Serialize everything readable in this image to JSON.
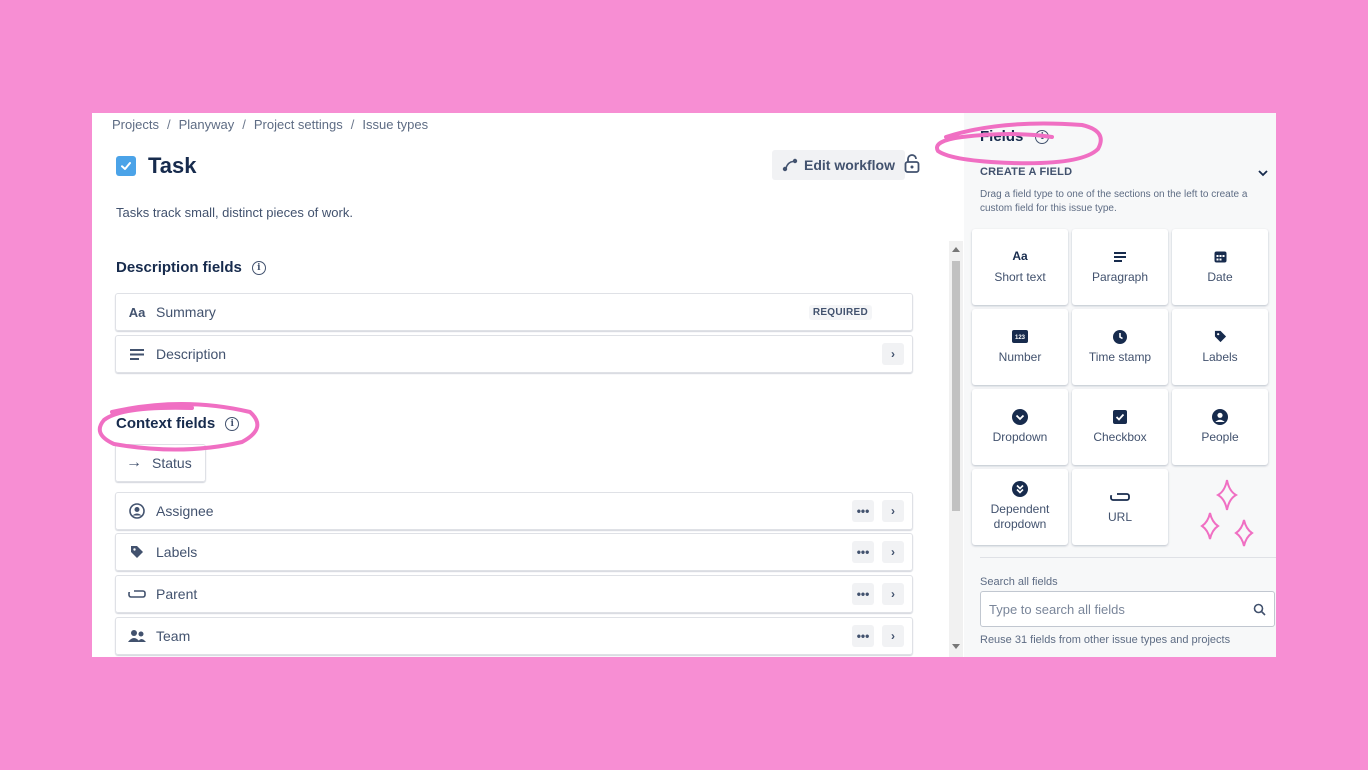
{
  "breadcrumb": [
    "Projects",
    "Planyway",
    "Project settings",
    "Issue types"
  ],
  "issue_type": {
    "title": "Task",
    "description": "Tasks track small, distinct pieces of work."
  },
  "toolbar": {
    "edit_workflow_label": "Edit workflow"
  },
  "description_fields": {
    "title": "Description fields",
    "items": [
      {
        "icon": "text-icon",
        "label": "Summary",
        "badge": "REQUIRED"
      },
      {
        "icon": "paragraph-icon",
        "label": "Description"
      }
    ]
  },
  "context_fields": {
    "title": "Context fields",
    "status_label": "Status",
    "items": [
      {
        "icon": "person-icon",
        "label": "Assignee"
      },
      {
        "icon": "tag-icon",
        "label": "Labels"
      },
      {
        "icon": "link-icon",
        "label": "Parent"
      },
      {
        "icon": "team-icon",
        "label": "Team"
      }
    ]
  },
  "fields_panel": {
    "title": "Fields",
    "create_label": "CREATE A FIELD",
    "help_text": "Drag a field type to one of the sections on the left to create a custom field for this issue type.",
    "tiles": [
      {
        "icon": "text-icon",
        "label": "Short text"
      },
      {
        "icon": "paragraph-icon",
        "label": "Paragraph"
      },
      {
        "icon": "calendar-icon",
        "label": "Date"
      },
      {
        "icon": "number-icon",
        "label": "Number"
      },
      {
        "icon": "clock-icon",
        "label": "Time stamp"
      },
      {
        "icon": "tag-icon",
        "label": "Labels"
      },
      {
        "icon": "chevron-circle-icon",
        "label": "Dropdown"
      },
      {
        "icon": "checkbox-icon",
        "label": "Checkbox"
      },
      {
        "icon": "person-icon",
        "label": "People"
      },
      {
        "icon": "double-chevron-circle-icon",
        "label": "Dependent dropdown"
      },
      {
        "icon": "link-icon",
        "label": "URL"
      }
    ],
    "search_label": "Search all fields",
    "search_placeholder": "Type to search all fields",
    "reuse_text": "Reuse 31 fields from other issue types and projects"
  },
  "colors": {
    "background": "#f78ed3",
    "annotation": "#f06fc3",
    "task_icon": "#4ba3e8"
  }
}
